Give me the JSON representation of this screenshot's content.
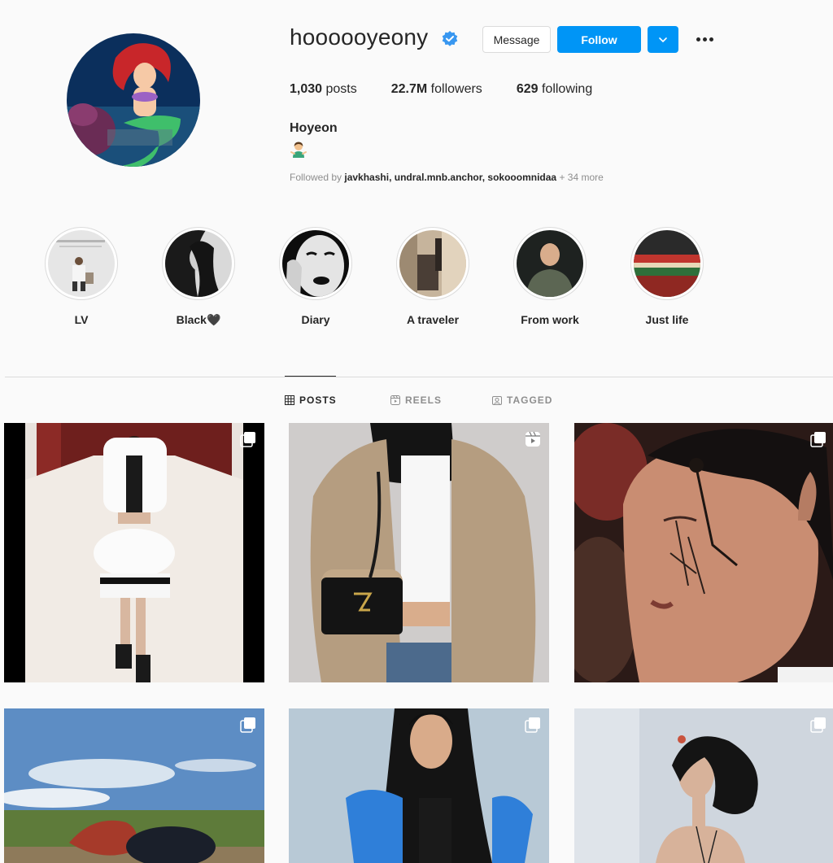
{
  "profile": {
    "username": "hoooooyeony",
    "verified_icon": "verified-badge-icon",
    "buttons": {
      "message": "Message",
      "follow": "Follow"
    },
    "stats": [
      {
        "value": "1,030",
        "label": "posts"
      },
      {
        "value": "22.7M",
        "label": "followers"
      },
      {
        "value": "629",
        "label": "following"
      }
    ],
    "full_name": "Hoyeon",
    "bio_emoji_icon": "person-gesturing-emoji-icon",
    "followed_by": {
      "prefix": "Followed by",
      "names": "javkhashi, undral.mnb.anchor, sokooomnidaa",
      "more": "+ 34 more"
    }
  },
  "highlights": [
    {
      "label": "LV"
    },
    {
      "label": "Black🖤"
    },
    {
      "label": "Diary"
    },
    {
      "label": "A traveler"
    },
    {
      "label": "From work"
    },
    {
      "label": "Just life"
    }
  ],
  "tabs": [
    {
      "label": "POSTS",
      "icon": "grid-icon",
      "active": true
    },
    {
      "label": "REELS",
      "icon": "reels-icon",
      "active": false
    },
    {
      "label": "TAGGED",
      "icon": "tagged-icon",
      "active": false
    }
  ],
  "posts": [
    {
      "type": "carousel",
      "icon": "carousel-icon"
    },
    {
      "type": "reel",
      "icon": "reel-icon"
    },
    {
      "type": "carousel",
      "icon": "carousel-icon"
    },
    {
      "type": "carousel",
      "icon": "carousel-icon"
    },
    {
      "type": "carousel",
      "icon": "carousel-icon"
    },
    {
      "type": "carousel",
      "icon": "carousel-icon"
    }
  ],
  "colors": {
    "accent": "#0095f6",
    "text": "#262626",
    "muted": "#8e8e8e",
    "border": "#dbdbdb",
    "background": "#fafafa"
  }
}
